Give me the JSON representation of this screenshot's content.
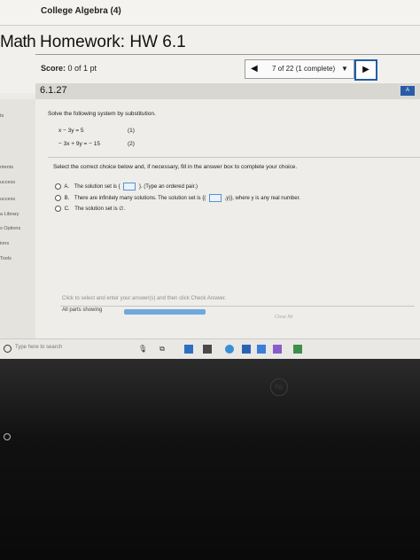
{
  "topbar": {
    "course_title": "College Algebra (4)"
  },
  "header": {
    "brand": "Math",
    "title": "Homework: HW 6.1",
    "score_label": "Score:",
    "score_value": "0 of 1 pt",
    "nav_prev_label": "◀",
    "nav_progress": "7 of 22 (1 complete)",
    "nav_dropdown_caret": "▼",
    "nav_next_label": "▶"
  },
  "question": {
    "number": "6.1.27",
    "help_label": "A",
    "prompt": "Solve the following system by substitution.",
    "equations": [
      {
        "expr": "x − 3y = 5",
        "tag": "(1)"
      },
      {
        "expr": "− 3x + 9y = − 15",
        "tag": "(2)"
      }
    ],
    "instruction": "Select the correct choice below and, if necessary, fill in the answer box to complete your choice.",
    "options": [
      {
        "letter": "A.",
        "text_before": "The solution set is {",
        "text_after": "}. (Type an ordered pair.)"
      },
      {
        "letter": "B.",
        "text_before": "There are infinitely many solutions. The solution set is {(",
        "text_after": ",y)}, where y is any real number."
      },
      {
        "letter": "C.",
        "text_before": "The solution set is ∅.",
        "text_after": ""
      }
    ],
    "bottom_hint": "Click to select and enter your answer(s) and then click Check Answer.",
    "all_parts_label": "All parts showing",
    "clear_all_label": "Clear All"
  },
  "sidebar": {
    "items": [
      "ts",
      "ntents",
      "uccess",
      "uccess",
      "a Library",
      "s Options",
      "ions",
      "Tools"
    ]
  },
  "taskbar": {
    "search_placeholder": "Type here to search"
  },
  "colors": {
    "accent": "#1e5fa8",
    "progress": "#6fa8dc"
  }
}
